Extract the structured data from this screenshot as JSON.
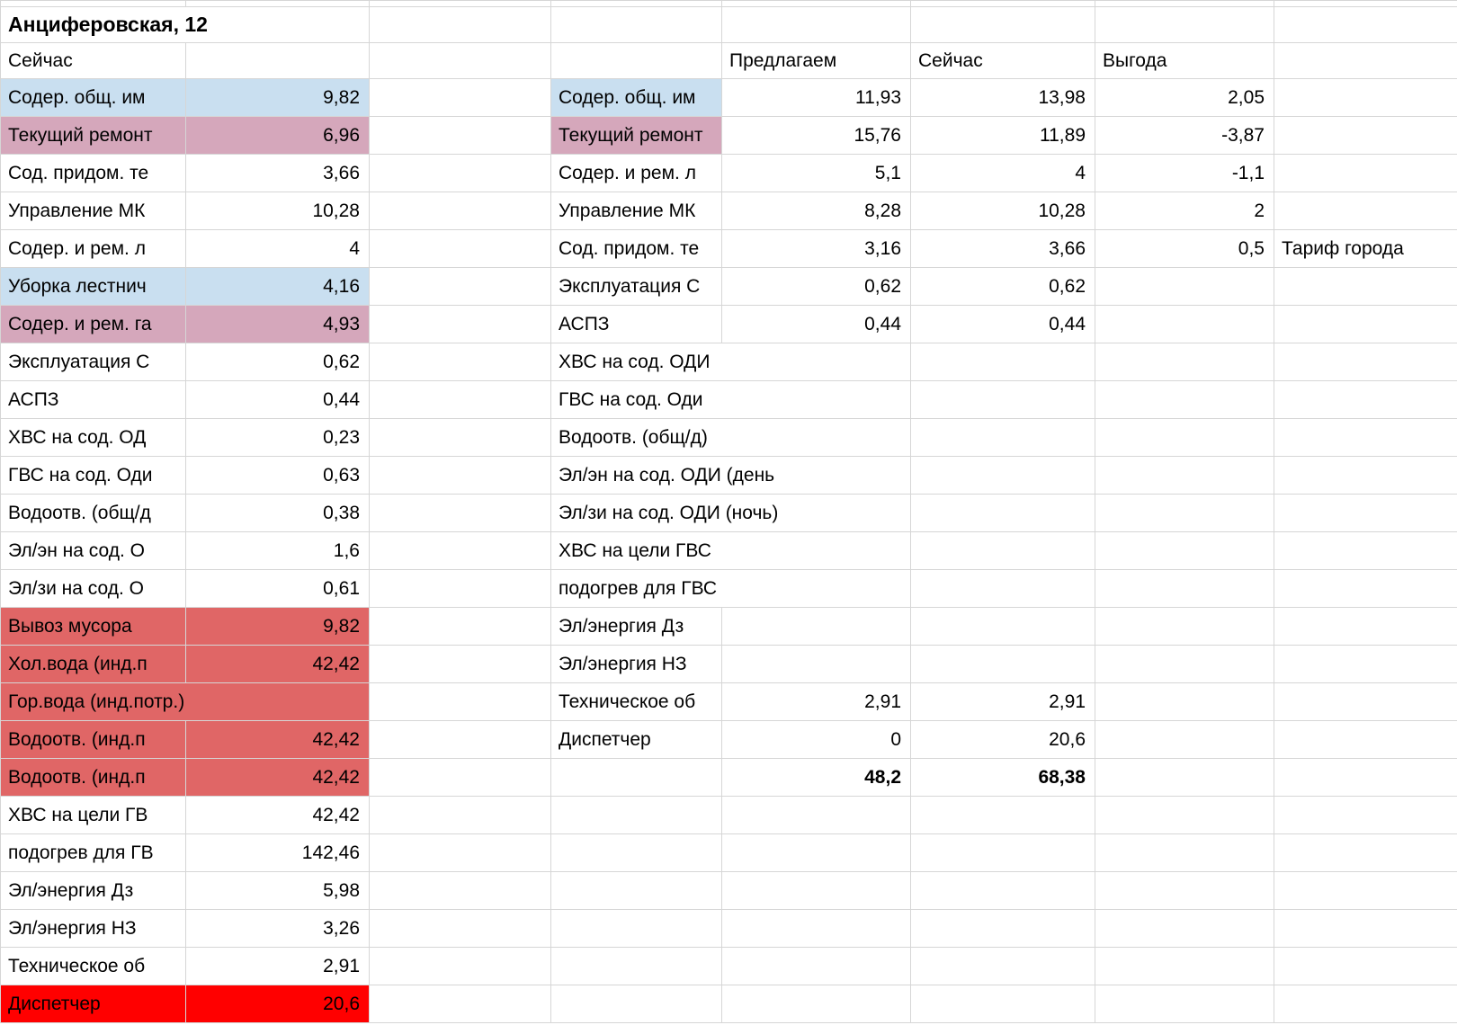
{
  "sheet": {
    "title": "Анциферовская, 12",
    "left": {
      "header": "Сейчас",
      "rows": [
        {
          "label": "Содер. общ. им",
          "value": "9,82",
          "hl": "blue",
          "span": false
        },
        {
          "label": "Текущий ремонт",
          "value": "6,96",
          "hl": "pink",
          "span": false
        },
        {
          "label": "Сод. придом. те",
          "value": "3,66",
          "hl": "",
          "span": false
        },
        {
          "label": "Управление МК",
          "value": "10,28",
          "hl": "",
          "span": false
        },
        {
          "label": "Содер. и рем. л",
          "value": "4",
          "hl": "",
          "span": false
        },
        {
          "label": "Уборка лестнич",
          "value": "4,16",
          "hl": "blue",
          "span": false
        },
        {
          "label": "Содер. и рем. га",
          "value": "4,93",
          "hl": "pink",
          "span": false
        },
        {
          "label": "Эксплуатация С",
          "value": "0,62",
          "hl": "",
          "span": false
        },
        {
          "label": "АСПЗ",
          "value": "0,44",
          "hl": "",
          "span": false
        },
        {
          "label": "ХВС на сод. ОД",
          "value": "0,23",
          "hl": "",
          "span": false
        },
        {
          "label": "ГВС на сод. Оди",
          "value": "0,63",
          "hl": "",
          "span": false
        },
        {
          "label": "Водоотв. (общ/д",
          "value": "0,38",
          "hl": "",
          "span": false
        },
        {
          "label": "Эл/эн на сод. О",
          "value": "1,6",
          "hl": "",
          "span": false
        },
        {
          "label": "Эл/зи на сод. О",
          "value": "0,61",
          "hl": "",
          "span": false
        },
        {
          "label": "Вывоз мусора",
          "value": "9,82",
          "hl": "red",
          "span": false
        },
        {
          "label": "Хол.вода (инд.п",
          "value": "42,42",
          "hl": "red",
          "span": false
        },
        {
          "label": "Гор.вода (инд.потр.)",
          "value": "",
          "hl": "red",
          "span": true
        },
        {
          "label": "Водоотв. (инд.п",
          "value": "42,42",
          "hl": "red",
          "span": false
        },
        {
          "label": "Водоотв. (инд.п",
          "value": "42,42",
          "hl": "red",
          "span": false
        },
        {
          "label": "ХВС на цели ГВ",
          "value": "42,42",
          "hl": "",
          "span": false
        },
        {
          "label": "подогрев для ГВ",
          "value": "142,46",
          "hl": "",
          "span": false
        },
        {
          "label": "Эл/энергия Дз",
          "value": "5,98",
          "hl": "",
          "span": false
        },
        {
          "label": "Эл/энергия НЗ",
          "value": "3,26",
          "hl": "",
          "span": false
        },
        {
          "label": "Техническое об",
          "value": "2,91",
          "hl": "",
          "span": false
        },
        {
          "label": "Диспетчер",
          "value": "20,6",
          "hl": "bright_red",
          "span": false
        }
      ]
    },
    "right": {
      "headers": {
        "offer": "Предлагаем",
        "current": "Сейчас",
        "benefit": "Выгода"
      },
      "rows": [
        {
          "label": "Содер. общ. им",
          "offer": "11,93",
          "current": "13,98",
          "benefit": "2,05",
          "note": "",
          "hl": "blue",
          "span": false
        },
        {
          "label": "Текущий ремонт",
          "offer": "15,76",
          "current": "11,89",
          "benefit": "-3,87",
          "note": "",
          "hl": "pink",
          "span": false
        },
        {
          "label": "Содер. и рем. л",
          "offer": "5,1",
          "current": "4",
          "benefit": "-1,1",
          "note": "",
          "hl": "",
          "span": false
        },
        {
          "label": "Управление МК",
          "offer": "8,28",
          "current": "10,28",
          "benefit": "2",
          "note": "",
          "hl": "",
          "span": false
        },
        {
          "label": "Сод. придом. те",
          "offer": "3,16",
          "current": "3,66",
          "benefit": "0,5",
          "note": "Тариф города",
          "hl": "",
          "span": false
        },
        {
          "label": "Эксплуатация С",
          "offer": "0,62",
          "current": "0,62",
          "benefit": "",
          "note": "",
          "hl": "",
          "span": false
        },
        {
          "label": "АСПЗ",
          "offer": "0,44",
          "current": "0,44",
          "benefit": "",
          "note": "",
          "hl": "",
          "span": false
        },
        {
          "label": "ХВС на сод. ОДИ",
          "offer": "",
          "current": "",
          "benefit": "",
          "note": "",
          "hl": "",
          "span": true
        },
        {
          "label": "ГВС на сод. Оди",
          "offer": "",
          "current": "",
          "benefit": "",
          "note": "",
          "hl": "",
          "span": true
        },
        {
          "label": "Водоотв. (общ/д)",
          "offer": "",
          "current": "",
          "benefit": "",
          "note": "",
          "hl": "",
          "span": true
        },
        {
          "label": "Эл/эн на сод. ОДИ (день",
          "offer": "",
          "current": "",
          "benefit": "",
          "note": "",
          "hl": "",
          "span": true
        },
        {
          "label": "Эл/зи на сод. ОДИ (ночь)",
          "offer": "",
          "current": "",
          "benefit": "",
          "note": "",
          "hl": "",
          "span": true
        },
        {
          "label": "ХВС на цели ГВС",
          "offer": "",
          "current": "",
          "benefit": "",
          "note": "",
          "hl": "",
          "span": true
        },
        {
          "label": "подогрев для ГВС",
          "offer": "",
          "current": "",
          "benefit": "",
          "note": "",
          "hl": "",
          "span": true
        },
        {
          "label": "Эл/энергия Дз",
          "offer": "",
          "current": "",
          "benefit": "",
          "note": "",
          "hl": "",
          "span": false
        },
        {
          "label": "Эл/энергия НЗ",
          "offer": "",
          "current": "",
          "benefit": "",
          "note": "",
          "hl": "",
          "span": false
        },
        {
          "label": "Техническое об",
          "offer": "2,91",
          "current": "2,91",
          "benefit": "",
          "note": "",
          "hl": "",
          "span": false
        },
        {
          "label": "Диспетчер",
          "offer": "0",
          "current": "20,6",
          "benefit": "",
          "note": "",
          "hl": "",
          "span": false
        }
      ],
      "totals": {
        "offer": "48,2",
        "current": "68,38"
      }
    },
    "colors": {
      "highlight_blue": "#C9DFF0",
      "highlight_pink": "#D5A7BB",
      "highlight_red": "#E06666",
      "highlight_bright_red": "#FF0000",
      "gridline": "#D6D6D6"
    }
  }
}
